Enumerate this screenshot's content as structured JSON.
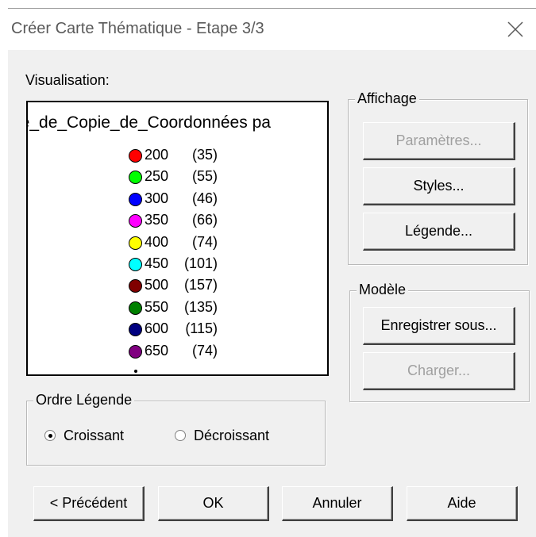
{
  "window": {
    "title": "Créer Carte Thématique - Etape 3/3",
    "close_icon": "close-icon"
  },
  "visualisation": {
    "label": "Visualisation:",
    "layer_name": "ie_de_Copie_de_Coordonnées pa",
    "legend": [
      {
        "value": "200",
        "count": "(35)",
        "color": "#ff0000"
      },
      {
        "value": "250",
        "count": "(55)",
        "color": "#00ff00"
      },
      {
        "value": "300",
        "count": "(46)",
        "color": "#0000ff"
      },
      {
        "value": "350",
        "count": "(66)",
        "color": "#ff00ff"
      },
      {
        "value": "400",
        "count": "(74)",
        "color": "#ffff00"
      },
      {
        "value": "450",
        "count": "(101)",
        "color": "#00ffff"
      },
      {
        "value": "500",
        "count": "(157)",
        "color": "#800000"
      },
      {
        "value": "550",
        "count": "(135)",
        "color": "#008000"
      },
      {
        "value": "600",
        "count": "(115)",
        "color": "#000080"
      },
      {
        "value": "650",
        "count": "(74)",
        "color": "#800080"
      }
    ]
  },
  "affichage": {
    "title": "Affichage",
    "parametres": "Paramètres...",
    "styles": "Styles...",
    "legende": "Légende..."
  },
  "modele": {
    "title": "Modèle",
    "enregistrer": "Enregistrer sous...",
    "charger": "Charger..."
  },
  "ordre": {
    "title": "Ordre Légende",
    "croissant": "Croissant",
    "decroissant": "Décroissant",
    "selected": "croissant"
  },
  "footer": {
    "precedent": "< Précédent",
    "ok": "OK",
    "annuler": "Annuler",
    "aide": "Aide"
  }
}
